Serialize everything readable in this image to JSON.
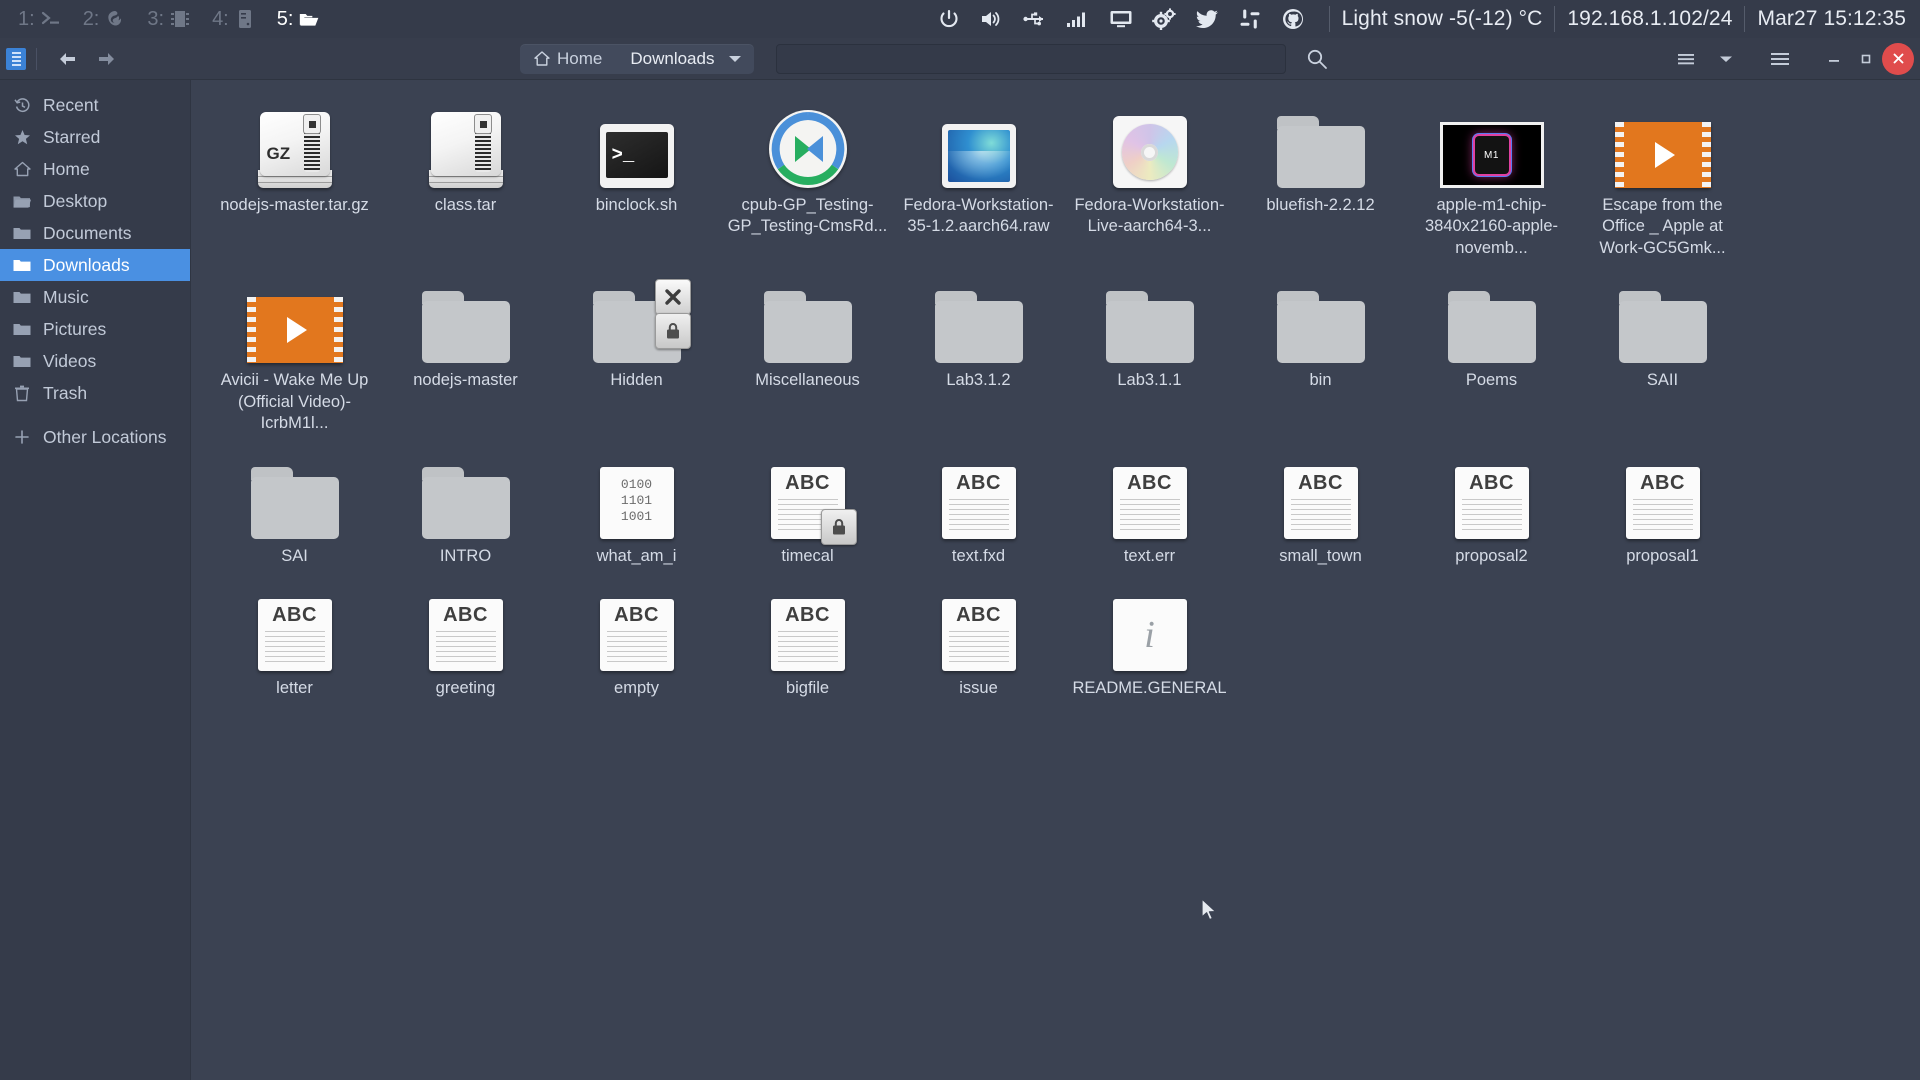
{
  "panel": {
    "workspaces": [
      {
        "num": "1:",
        "icon": "terminal-icon",
        "active": false
      },
      {
        "num": "2:",
        "icon": "firefox-icon",
        "active": false
      },
      {
        "num": "3:",
        "icon": "chip-icon",
        "active": false
      },
      {
        "num": "4:",
        "icon": "server-icon",
        "active": false
      },
      {
        "num": "5:",
        "icon": "folder-open-icon",
        "active": true
      }
    ],
    "tray": [
      "power-icon",
      "volume-icon",
      "usb-icon",
      "signal-bars-icon",
      "display-icon",
      "gears-icon",
      "twitter-icon",
      "slack-icon",
      "github-icon"
    ],
    "weather": "Light snow -5(-12) °C",
    "network": "192.168.1.102/24",
    "datetime": "Mar27 15:12:35"
  },
  "headerbar": {
    "back_icon": "arrow-left-icon",
    "forward_icon": "arrow-right-icon",
    "breadcrumbs": [
      {
        "label": "Home",
        "icon": "home-icon",
        "current": false
      },
      {
        "label": "Downloads",
        "icon": "",
        "current": true
      }
    ],
    "path_caret_icon": "chevron-down-icon",
    "search_icon": "search-icon",
    "search_value": "",
    "search_placeholder": "",
    "view_toggle_icon": "list-view-icon",
    "view_caret_icon": "chevron-down-icon",
    "menu_icon": "hamburger-menu-icon",
    "minimize_label": "–",
    "maximize_label": "▫",
    "close_label": "✕"
  },
  "sidebar": {
    "items": [
      {
        "label": "Recent",
        "icon": "clock-recent-icon",
        "selected": false
      },
      {
        "label": "Starred",
        "icon": "star-icon",
        "selected": false
      },
      {
        "label": "Home",
        "icon": "home-icon",
        "selected": false
      },
      {
        "label": "Desktop",
        "icon": "folder-open-icon",
        "selected": false
      },
      {
        "label": "Documents",
        "icon": "folder-icon",
        "selected": false
      },
      {
        "label": "Downloads",
        "icon": "folder-icon",
        "selected": true
      },
      {
        "label": "Music",
        "icon": "folder-icon",
        "selected": false
      },
      {
        "label": "Pictures",
        "icon": "folder-icon",
        "selected": false
      },
      {
        "label": "Videos",
        "icon": "folder-icon",
        "selected": false
      },
      {
        "label": "Trash",
        "icon": "trash-icon",
        "selected": false
      },
      {
        "label": "Other Locations",
        "icon": "plus-icon",
        "selected": false
      }
    ]
  },
  "files": [
    {
      "name": "nodejs-master.tar.gz",
      "kind": "archive",
      "badge": "GZ"
    },
    {
      "name": "class.tar",
      "kind": "archive",
      "badge": ""
    },
    {
      "name": "binclock.sh",
      "kind": "script"
    },
    {
      "name": "cpub-GP_Testing-GP_Testing-CmsRd...",
      "kind": "cpub"
    },
    {
      "name": "Fedora-Workstation-35-1.2.aarch64.raw",
      "kind": "image"
    },
    {
      "name": "Fedora-Workstation-Live-aarch64-3...",
      "kind": "iso"
    },
    {
      "name": "bluefish-2.2.12",
      "kind": "folder"
    },
    {
      "name": "apple-m1-chip-3840x2160-apple-novemb...",
      "kind": "poster"
    },
    {
      "name": "Escape from the Office _ Apple at Work-GC5Gmk...",
      "kind": "video"
    },
    {
      "name": "Avicii - Wake Me Up (Official Video)-IcrbM1l...",
      "kind": "video"
    },
    {
      "name": "nodejs-master",
      "kind": "folder"
    },
    {
      "name": "Hidden",
      "kind": "folder",
      "emblems": [
        "close-emblem-icon",
        "lock-emblem-icon"
      ]
    },
    {
      "name": "Miscellaneous",
      "kind": "folder"
    },
    {
      "name": "Lab3.1.2",
      "kind": "folder"
    },
    {
      "name": "Lab3.1.1",
      "kind": "folder"
    },
    {
      "name": "bin",
      "kind": "folder"
    },
    {
      "name": "Poems",
      "kind": "folder"
    },
    {
      "name": "SAII",
      "kind": "folder"
    },
    {
      "name": "SAI",
      "kind": "folder"
    },
    {
      "name": "INTRO",
      "kind": "folder"
    },
    {
      "name": "what_am_i",
      "kind": "binary",
      "bin_lines": "0100\n1101\n1001"
    },
    {
      "name": "timecal",
      "kind": "text",
      "emblems": [
        "lock-emblem-icon"
      ]
    },
    {
      "name": "text.fxd",
      "kind": "text"
    },
    {
      "name": "text.err",
      "kind": "text"
    },
    {
      "name": "small_town",
      "kind": "text"
    },
    {
      "name": "proposal2",
      "kind": "text"
    },
    {
      "name": "proposal1",
      "kind": "text"
    },
    {
      "name": "letter",
      "kind": "text"
    },
    {
      "name": "greeting",
      "kind": "text"
    },
    {
      "name": "empty",
      "kind": "text"
    },
    {
      "name": "bigfile",
      "kind": "text"
    },
    {
      "name": "issue",
      "kind": "text"
    },
    {
      "name": "README.GENERAL",
      "kind": "info"
    }
  ],
  "doc_label": "ABC",
  "colors": {
    "panel_bg": "#353b4a",
    "window_bg": "#3b4252",
    "sidebar_bg": "#353b4a",
    "accent": "#4a90e2",
    "close_red": "#e04c4c",
    "text": "#d5dbe6",
    "video_orange": "#e2771e"
  }
}
